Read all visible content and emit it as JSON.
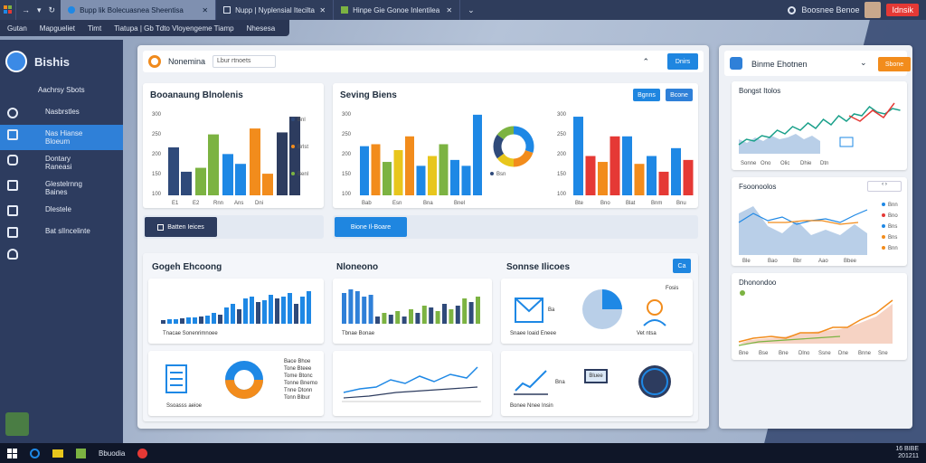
{
  "browser": {
    "tabs": [
      {
        "label": "Bupp lik Bolecuasnea Sheentisa",
        "active": true
      },
      {
        "label": "Nupp | Nyplensial Iteciltaltio",
        "active": false
      },
      {
        "label": "Hinpe Gie Gonoe Inlentilea",
        "active": false
      }
    ],
    "bookmarks": [
      "Gutan",
      "Mapgueliet",
      "Timt",
      "Tiatupa | Gb  Tdto Vloyengeme Tiamp",
      "Nhesesa"
    ],
    "user_name": "Boosnee Benoe",
    "user_action": "Idnsik"
  },
  "sidebar": {
    "brand": "Bishis",
    "items": [
      {
        "label": "Aachrsy Sbots",
        "icon": "tag-icon"
      },
      {
        "label": "Nasbrstles",
        "icon": "tool-icon"
      },
      {
        "label": "Nas Hianse\nBloeum",
        "icon": "document-icon",
        "active": true
      },
      {
        "label": "Dontary\nRaneasi",
        "icon": "chat-icon"
      },
      {
        "label": "Glestelrnng\nBaines",
        "icon": "export-icon"
      },
      {
        "label": "Dlestele",
        "icon": "file-icon"
      },
      {
        "label": "Bat slIncelinte",
        "icon": "building-icon"
      },
      {
        "label": "",
        "icon": "cloud-icon"
      }
    ]
  },
  "main": {
    "topbar": {
      "title": "Nonemina",
      "search_placeholder": "Lbur rtnoets",
      "action": "Dnirs"
    },
    "card1": {
      "title": "Booanaung Blnolenis"
    },
    "card2": {
      "title": "Seving Biens",
      "btn1": "Bgnns",
      "btn2": "Bcone"
    },
    "buttons": {
      "dark": "Batten Ieices",
      "blue": "Bione Il-Boare"
    },
    "section2": {
      "title1": "Gogeh Ehcoong",
      "title2": "Nloneono",
      "title3": "Sonnse Ilicoes",
      "btn": "Ca"
    },
    "tiles": {
      "t1_caption": "Tnacae Sonenrimnoee",
      "t2_caption": "Tbnae Bonae",
      "t3_caption": "Snaee Ioaid Eneee",
      "t3_label": "Ba",
      "t3_icon_label": "Fosis",
      "t3_bottom": "Vet ntsa",
      "t4_caption": "Ssoasss aeioe",
      "t4_rows": [
        "Bace Bhoe",
        "Tone Bteee",
        "Tome Btonc",
        "Tonne Bnemo",
        "Tnne Dtonn",
        "Tonn Blbur"
      ],
      "t6_caption": "Bonee Nnee Insin",
      "t6_label": "Bna",
      "t6_box": "Bluee"
    }
  },
  "right_panel": {
    "title": "Binme Ehotnen",
    "btn": "Sbone",
    "chart1_title": "Bongst Itolos",
    "chart1_xlabels": [
      "Sonne",
      "Ono",
      "Olic",
      "Dhie",
      "Dtn"
    ],
    "chart2_title": "Fsoonoolos",
    "chart2_legend": [
      "Bnn",
      "Bno",
      "Bns",
      "Bns",
      "Bnn"
    ],
    "chart2_xlabels": [
      "Ble",
      "Bao",
      "Bbr",
      "Aao",
      "Bbee"
    ],
    "chart3_title": "Dhonondoo",
    "chart3_xlabels": [
      "Bne",
      "Bse",
      "Bne",
      "Dlno",
      "Ssne",
      "Dne",
      "Bnne",
      "Sne"
    ]
  },
  "taskbar": {
    "app_label": "Bbuodia",
    "clock_time": "16 BIBE",
    "clock_date": "201211"
  },
  "chart_data": [
    {
      "type": "bar",
      "title": "Booanaung Blnolenis",
      "categories": [
        "E1",
        "E2",
        "Rnn",
        "Ans",
        "Dni"
      ],
      "series": [
        {
          "values": [
            122,
            60
          ]
        },
        {
          "values": [
            70,
            155
          ]
        },
        {
          "values": [
            105,
            80
          ]
        },
        {
          "values": [
            170,
            55
          ]
        },
        {
          "values": [
            160,
            200
          ]
        }
      ],
      "legend": [
        "Bnl",
        "Brlst",
        "Benl"
      ],
      "ylim": [
        0,
        230
      ],
      "yticks": [
        100,
        150,
        200,
        250,
        300
      ],
      "colors": [
        "#2f4a7a",
        "#7cb342",
        "#1e88e5",
        "#f28c1c",
        "#2d3c5f"
      ]
    },
    {
      "type": "bar",
      "title": "Seving Biens",
      "categories": [
        "Bab",
        "Esn",
        "Bna",
        "Bnel"
      ],
      "values": [
        125,
        130,
        85,
        115,
        150,
        75,
        100,
        130,
        90,
        75,
        205
      ],
      "yticks": [
        100,
        150,
        200,
        250,
        300
      ],
      "colors": [
        "#1e88e5",
        "#f28c1c",
        "#7cb342",
        "#e8c61c",
        "#f28c1c",
        "#1e88e5",
        "#e8c61c",
        "#7cb342",
        "#1e88e5",
        "#1e88e5",
        "#1e88e5"
      ]
    },
    {
      "type": "pie",
      "values": [
        30,
        20,
        15,
        20,
        15
      ],
      "colors": [
        "#1e88e5",
        "#f28c1c",
        "#e8c61c",
        "#2f4a7a",
        "#7cb342"
      ],
      "legend": [
        "Bsn"
      ]
    },
    {
      "type": "bar",
      "categories": [
        "Bte",
        "Bno",
        "Blat",
        "Bnm",
        "Bnu"
      ],
      "values": [
        200,
        100,
        85,
        150,
        150,
        80,
        100,
        60,
        120,
        90
      ],
      "yticks": [
        100,
        150,
        200,
        250,
        300
      ],
      "colors": [
        "#1e88e5",
        "#e53935",
        "#f28c1c",
        "#e53935",
        "#1e88e5",
        "#f28c1c",
        "#1e88e5",
        "#e53935",
        "#1e88e5",
        "#e53935"
      ]
    }
  ]
}
